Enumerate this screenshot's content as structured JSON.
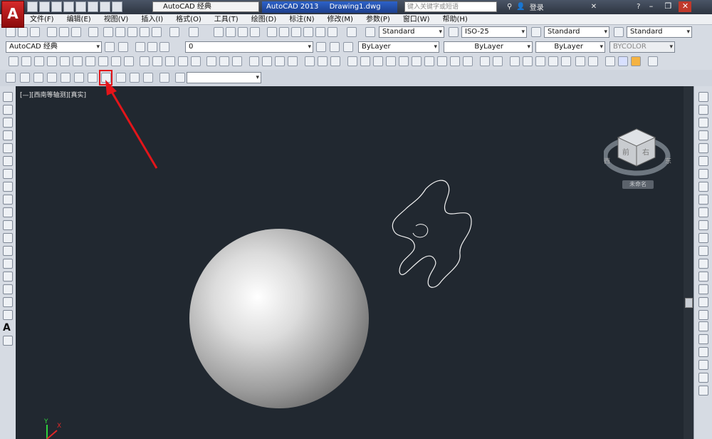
{
  "app": {
    "logo": "A",
    "workspace": "AutoCAD 经典",
    "title_app": "AutoCAD 2013",
    "title_doc": "Drawing1.dwg",
    "search_placeholder": "键入关键字或短语",
    "login": "登录"
  },
  "menu": [
    "文件(F)",
    "编辑(E)",
    "视图(V)",
    "插入(I)",
    "格式(O)",
    "工具(T)",
    "绘图(D)",
    "标注(N)",
    "修改(M)",
    "参数(P)",
    "窗口(W)",
    "帮助(H)"
  ],
  "toolbar1": {
    "text_style": "Standard",
    "dim_style": "ISO-25",
    "table_style": "Standard",
    "multileader_style": "Standard"
  },
  "toolbar2": {
    "workspace": "AutoCAD 经典",
    "layer": "0",
    "color": "ByLayer",
    "linetype": "ByLayer",
    "lineweight": "ByLayer",
    "plotstyle": "BYCOLOR"
  },
  "viewport": {
    "label": "[—][西南等轴测][真实]",
    "viewcube_unnamed": "未命名"
  },
  "colors": {
    "viewport_bg": "#212830",
    "highlight": "#e3151a"
  },
  "icons": [
    "new-icon",
    "open-icon",
    "save-icon",
    "print-icon",
    "undo-icon",
    "redo-icon",
    "pan-icon",
    "zoom-icon",
    "help-icon",
    "sphere-icon",
    "cube-icon",
    "arrow-annotation"
  ]
}
